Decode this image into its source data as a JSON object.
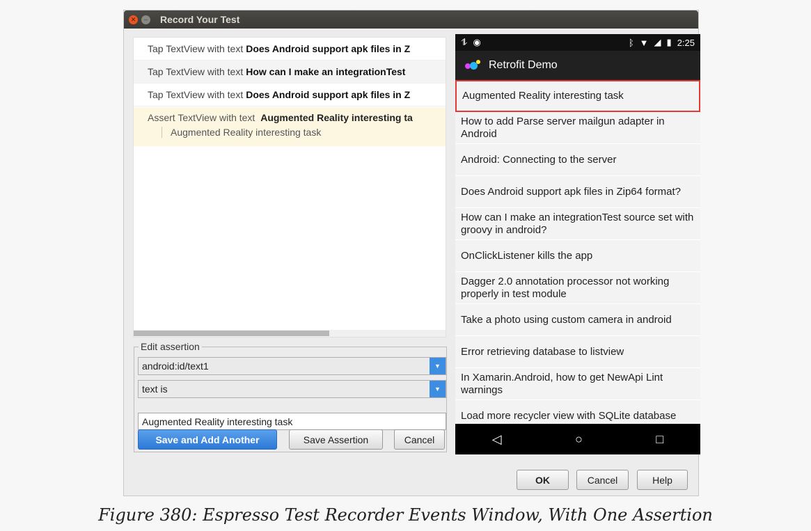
{
  "window": {
    "title": "Record Your Test"
  },
  "events": [
    {
      "prefix": "Tap TextView with text",
      "text": "Does Android support apk files in Z"
    },
    {
      "prefix": "Tap TextView with text",
      "text": "How can I make an integrationTest"
    },
    {
      "prefix": "Tap TextView with text",
      "text": "Does Android support apk files in Z"
    }
  ],
  "assertion_event": {
    "prefix": "Assert TextView with text",
    "text": "Augmented Reality interesting ta",
    "detail": "Augmented Reality interesting task"
  },
  "edit_assertion": {
    "legend": "Edit assertion",
    "view_id": "android:id/text1",
    "condition": "text is",
    "value": "Augmented Reality interesting task",
    "save_add_label": "Save and Add Another",
    "save_label": "Save Assertion",
    "cancel_label": "Cancel"
  },
  "phone": {
    "time": "2:25",
    "app_title": "Retrofit Demo",
    "list": [
      "Augmented Reality interesting task",
      "How to add Parse server mailgun adapter in Android",
      "Android: Connecting to the server",
      "Does Android support apk files in Zip64 format?",
      "How can I make an integrationTest source set with groovy in android?",
      "OnClickListener kills the app",
      "Dagger 2.0 annotation processor not working properly in test module",
      "Take a photo using custom camera in android",
      "Error retrieving database to listview",
      "In Xamarin.Android, how to get NewApi Lint warnings",
      "Load more recycler view with SQLite database"
    ]
  },
  "footer": {
    "ok_label": "OK",
    "cancel_label": "Cancel",
    "help_label": "Help"
  },
  "caption": "Figure 380: Espresso Test Recorder Events Window, With One Assertion",
  "colors": {
    "accent": "#3d8ee2",
    "highlight": "#e53935",
    "assertion_bg": "#fdf7e2"
  }
}
